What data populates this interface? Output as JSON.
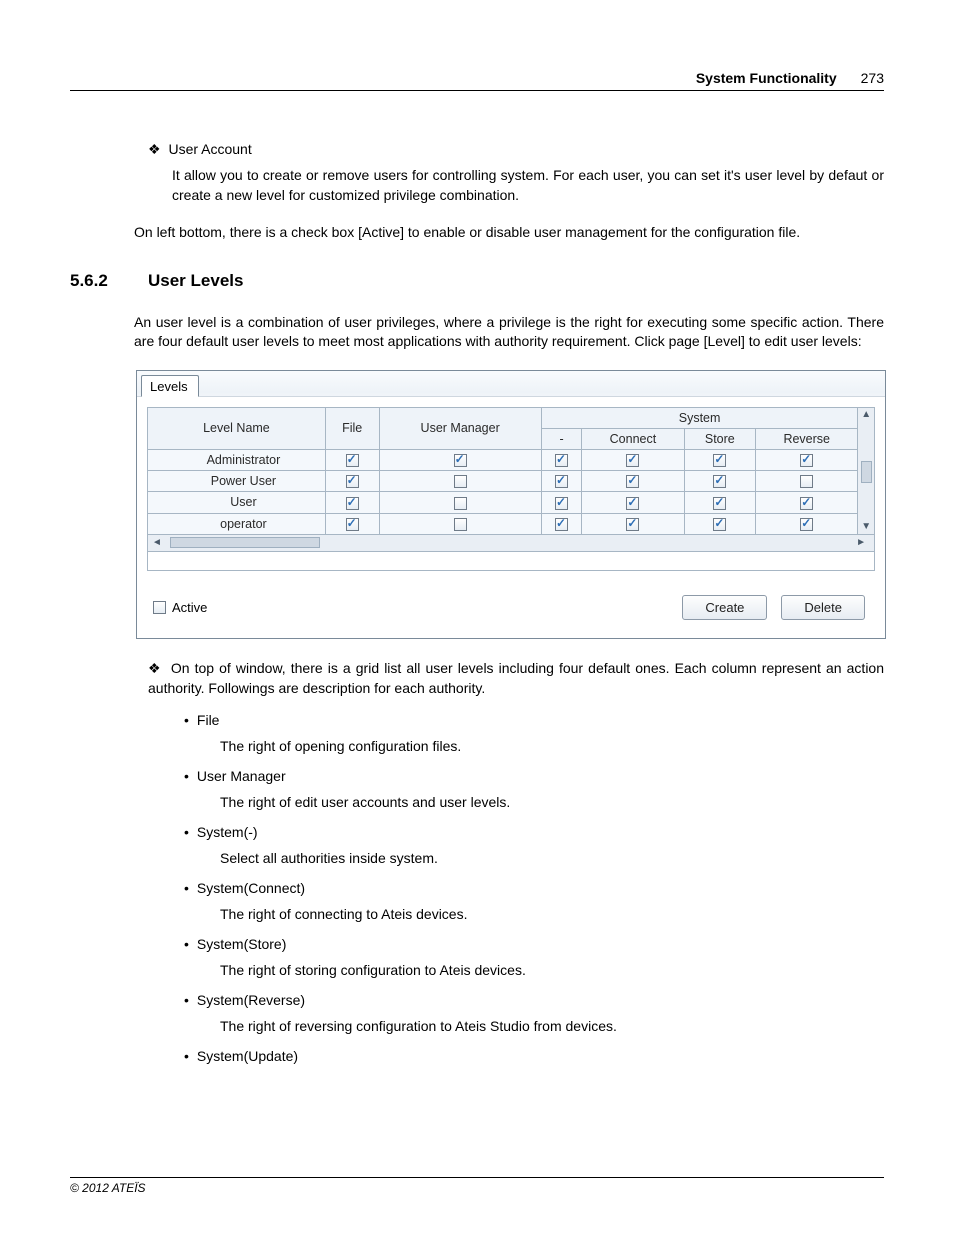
{
  "header": {
    "title": "System Functionality",
    "page": "273"
  },
  "sec_user_account": {
    "title": "User Account",
    "p1": "It allow you to create or remove users for controlling system. For each user, you can set it's user level by defaut or create a new level for customized privilege combination.",
    "p2": "On left bottom, there is a check box [Active] to enable or disable user management for the configuration file."
  },
  "section562": {
    "num": "5.6.2",
    "title": "User Levels"
  },
  "p562_intro": "An user level is a combination of user privileges, where a privilege is the right for executing some specific action. There are four default user levels to meet most applications with authority requirement. Click page [Level] to edit user levels:",
  "panel": {
    "tab": "Levels",
    "cols": {
      "levelname": "Level Name",
      "file": "File",
      "usermgr": "User Manager",
      "system": "System",
      "dash": "-",
      "connect": "Connect",
      "store": "Store",
      "reverse": "Reverse"
    },
    "rows": [
      {
        "name": "Administrator",
        "file": true,
        "usermgr": true,
        "dash": true,
        "connect": true,
        "store": true,
        "reverse": true
      },
      {
        "name": "Power User",
        "file": true,
        "usermgr": false,
        "dash": true,
        "connect": true,
        "store": true,
        "reverse": false
      },
      {
        "name": "User",
        "file": true,
        "usermgr": false,
        "dash": true,
        "connect": true,
        "store": true,
        "reverse": true
      },
      {
        "name": "operator",
        "file": true,
        "usermgr": false,
        "dash": true,
        "connect": true,
        "store": true,
        "reverse": true
      }
    ],
    "active_label": "Active",
    "create_label": "Create",
    "delete_label": "Delete"
  },
  "after_panel": "On top of window, there is a grid list all user levels including four default ones. Each column represent an action authority. Followings are description for each authority.",
  "auths": [
    {
      "t": "File",
      "d": "The right of opening configuration files."
    },
    {
      "t": "User Manager",
      "d": "The right of edit user accounts and user levels."
    },
    {
      "t": "System(-)",
      "d": "Select all authorities inside system."
    },
    {
      "t": "System(Connect)",
      "d": "The right of connecting to Ateis devices."
    },
    {
      "t": "System(Store)",
      "d": "The right of storing configuration to Ateis devices."
    },
    {
      "t": "System(Reverse)",
      "d": "The right of reversing configuration to Ateis Studio from devices."
    },
    {
      "t": "System(Update)",
      "d": ""
    }
  ],
  "footer": "© 2012 ATEÏS"
}
